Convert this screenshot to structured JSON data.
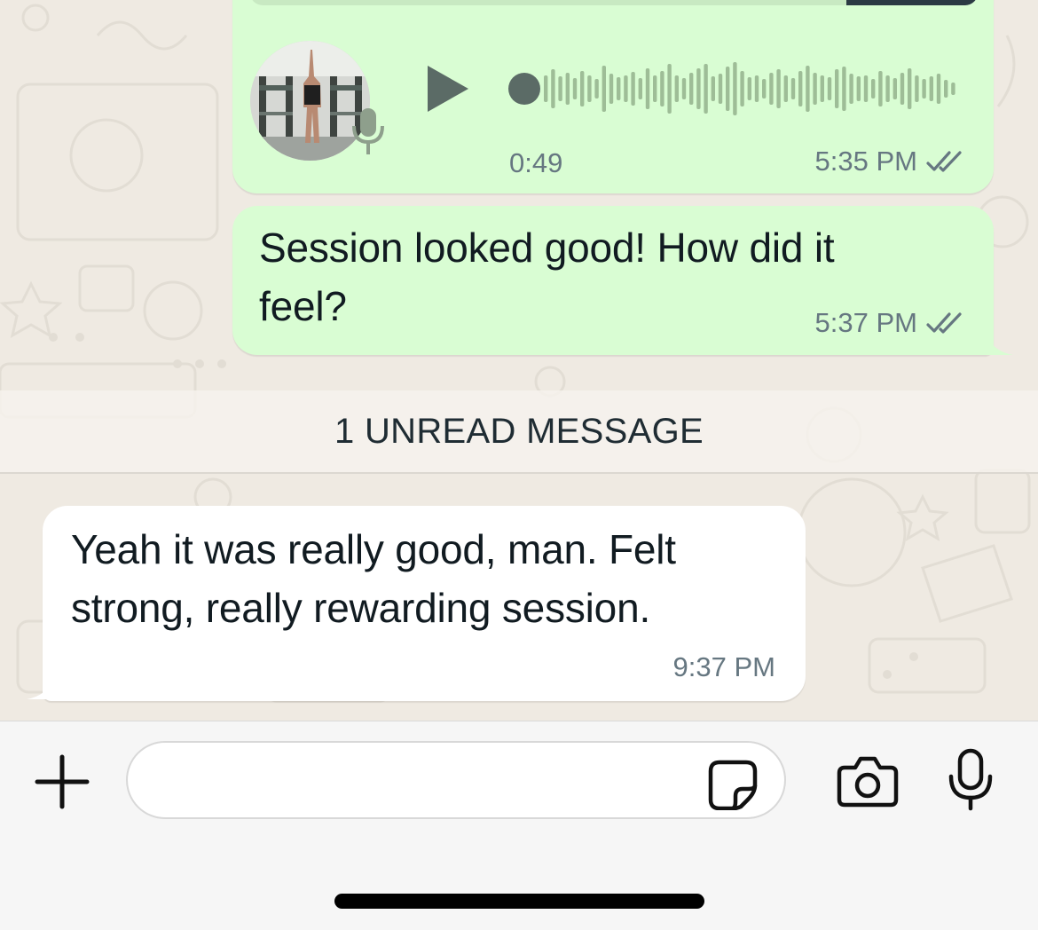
{
  "colors": {
    "outgoing_bubble": "#d9fdd3",
    "incoming_bubble": "#ffffff",
    "read_ticks": "#667781",
    "chat_background": "#efeae2"
  },
  "voice_message": {
    "duration": "0:49",
    "time": "5:35 PM",
    "status_icon": "double-check-icon"
  },
  "messages": [
    {
      "direction": "outgoing",
      "lines": [
        "Session looked good! How did it",
        "feel?"
      ],
      "time": "5:37 PM",
      "status_icon": "double-check-icon"
    },
    {
      "direction": "incoming",
      "lines": [
        "Yeah it was really good, man. Felt",
        "strong, really rewarding session."
      ],
      "time": "9:37 PM"
    }
  ],
  "unread_divider": "1 UNREAD MESSAGE",
  "composer": {
    "input_value": "",
    "icons": [
      "plus-icon",
      "sticker-icon",
      "camera-icon",
      "microphone-icon"
    ]
  }
}
